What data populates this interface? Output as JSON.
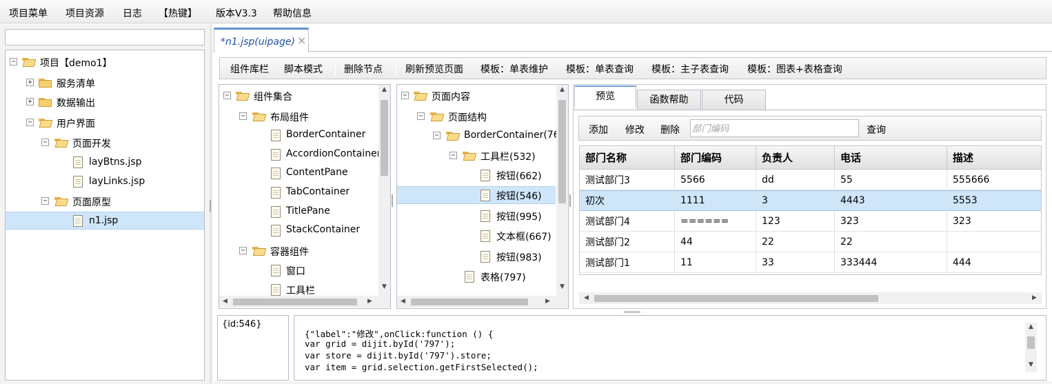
{
  "menubar": {
    "items": [
      "项目菜单",
      "项目资源",
      "日志",
      "【热键】",
      "版本V3.3",
      "帮助信息"
    ]
  },
  "left_tree": {
    "search_value": "",
    "items": [
      {
        "label": "项目【demo1】"
      },
      {
        "label": "服务清单"
      },
      {
        "label": "数据输出"
      },
      {
        "label": "用户界面"
      },
      {
        "label": "页面开发"
      },
      {
        "label": "layBtns.jsp"
      },
      {
        "label": "layLinks.jsp"
      },
      {
        "label": "页面原型"
      },
      {
        "label": "n1.jsp"
      }
    ]
  },
  "editor": {
    "tab_label": "*n1.jsp(uipage)",
    "tab_close": "×"
  },
  "toolbar": {
    "buttons": [
      "组件库栏",
      "脚本模式",
      "删除节点",
      "刷新预览页面",
      "模板：单表维护",
      "模板：单表查询",
      "模板：主子表查询",
      "模板：图表+表格查询"
    ]
  },
  "component_tree": {
    "items": [
      "组件集合",
      "布局组件",
      "BorderContainer",
      "AccordionContainer",
      "ContentPane",
      "TabContainer",
      "TitlePane",
      "StackContainer",
      "容器组件",
      "窗口",
      "工具栏"
    ]
  },
  "page_tree": {
    "items": [
      "页面内容",
      "页面结构",
      "BorderContainer(76",
      "工具栏(532)",
      "按钮(662)",
      "按钮(546)",
      "按钮(995)",
      "文本框(667)",
      "按钮(983)",
      "表格(797)"
    ]
  },
  "preview": {
    "tabs": [
      "预览",
      "函数帮助",
      "代码"
    ],
    "toolbar": {
      "add": "添加",
      "edit": "修改",
      "delete": "删除",
      "placeholder": "部门编码",
      "query": "查询"
    },
    "grid": {
      "columns": [
        "部门名称",
        "部门编码",
        "负责人",
        "电话",
        "描述"
      ],
      "rows": [
        [
          "测试部门3",
          "5566",
          "dd",
          "55",
          "555666"
        ],
        [
          "初次",
          "1111",
          "3",
          "4443",
          "5553"
        ],
        [
          "测试部门4",
          "======",
          "123",
          "323",
          "323"
        ],
        [
          "测试部门2",
          "44",
          "22",
          "22",
          ""
        ],
        [
          "测试部门1",
          "11",
          "33",
          "333444",
          "444"
        ]
      ]
    }
  },
  "bottom": {
    "id_text": "{id:546}",
    "code_lines": [
      "{\"label\":\"修改\",onClick:function () {",
      "var grid = dijit.byId('797');",
      "var store = dijit.byId('797').store;",
      "var item = grid.selection.getFirstSelected();"
    ]
  }
}
